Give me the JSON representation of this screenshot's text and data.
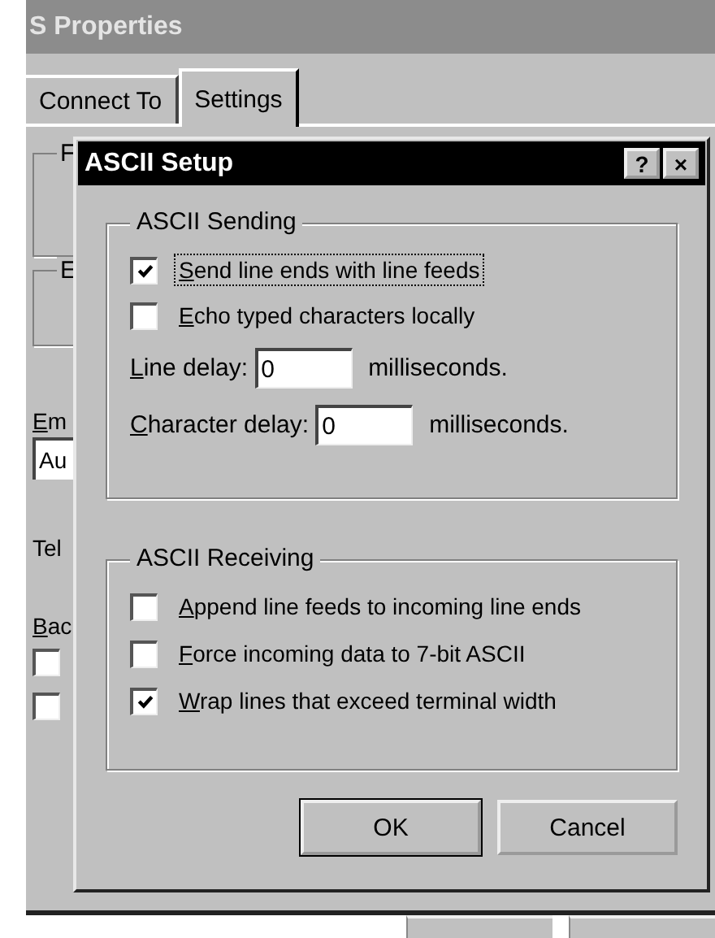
{
  "window": {
    "title": "S Properties"
  },
  "tabs": [
    {
      "label": "Connect To",
      "selected": false
    },
    {
      "label": "Settings",
      "selected": true
    }
  ],
  "background": {
    "groups": [
      {
        "legend": "F"
      },
      {
        "legend": "E"
      }
    ],
    "emulation_label": "Em",
    "emulation_value": "Au",
    "telnet_label": "Tel",
    "backscroll_label": "Bac",
    "checkboxes": [
      {
        "checked": false
      },
      {
        "checked": false
      }
    ]
  },
  "dialog": {
    "title": "ASCII Setup",
    "help": "?",
    "close": "×",
    "sending": {
      "legend": "ASCII Sending",
      "options": [
        {
          "label": "Send line ends with line feeds",
          "checked": true,
          "focused": true
        },
        {
          "label": "Echo typed characters locally",
          "checked": false,
          "focused": false
        }
      ],
      "fields": [
        {
          "label": "Line delay:",
          "value": "0",
          "unit": "milliseconds."
        },
        {
          "label": "Character delay:",
          "value": "0",
          "unit": "milliseconds."
        }
      ]
    },
    "receiving": {
      "legend": "ASCII Receiving",
      "options": [
        {
          "label": "Append line feeds to incoming line ends",
          "checked": false,
          "focused": false
        },
        {
          "label": "Force incoming data to 7-bit ASCII",
          "checked": false,
          "focused": false
        },
        {
          "label": "Wrap lines that exceed terminal width",
          "checked": true,
          "focused": false
        }
      ]
    },
    "buttons": [
      {
        "label": "OK",
        "default": true
      },
      {
        "label": "Cancel",
        "default": false
      }
    ]
  }
}
